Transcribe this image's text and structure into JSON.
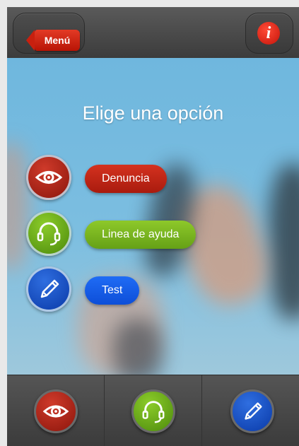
{
  "header": {
    "menu_label": "Menú",
    "info_icon": "info-icon",
    "info_glyph": "i"
  },
  "main": {
    "title": "Elige una opción",
    "options": [
      {
        "label": "Denuncia",
        "icon": "eye-icon",
        "color": "#b81d0e"
      },
      {
        "label": "Linea de ayuda",
        "icon": "headset-icon",
        "color": "#6aa517"
      },
      {
        "label": "Test",
        "icon": "pencil-icon",
        "color": "#0f55e0"
      }
    ]
  },
  "bottom_tabs": [
    {
      "icon": "eye-icon"
    },
    {
      "icon": "headset-icon"
    },
    {
      "icon": "pencil-icon"
    }
  ]
}
